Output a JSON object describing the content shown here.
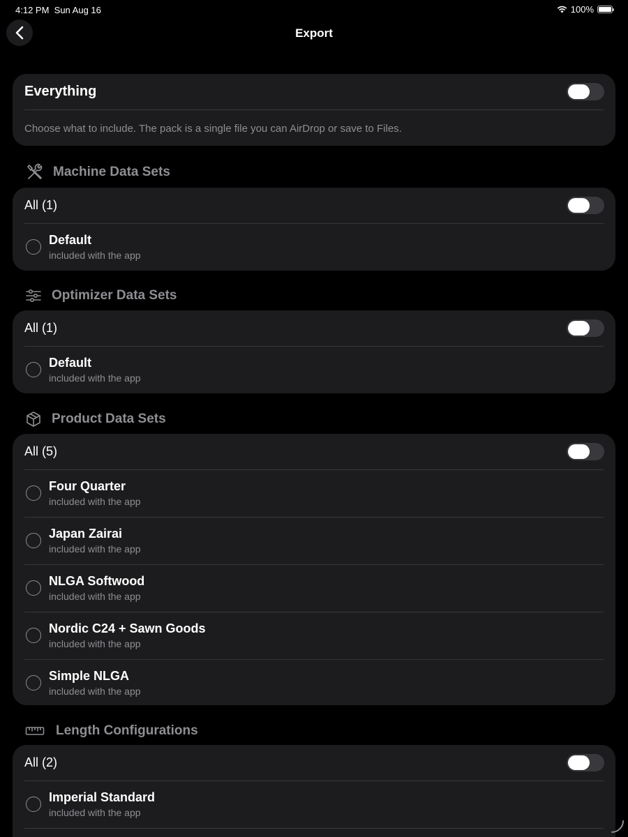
{
  "status": {
    "time": "4:12 PM",
    "date": "Sun Aug 16",
    "battery": "100%"
  },
  "nav": {
    "title": "Export"
  },
  "everything": {
    "label": "Everything",
    "description": "Choose what to include. The pack is a single file you can AirDrop or save to Files.",
    "toggle_on": false
  },
  "sections": [
    {
      "title": "Machine Data Sets",
      "icon": "tools-icon",
      "all_label": "All (1)",
      "toggle_on": false,
      "items": [
        {
          "title": "Default",
          "subtitle": "included with the app"
        }
      ]
    },
    {
      "title": "Optimizer Data Sets",
      "icon": "sliders-icon",
      "all_label": "All (1)",
      "toggle_on": false,
      "items": [
        {
          "title": "Default",
          "subtitle": "included with the app"
        }
      ]
    },
    {
      "title": "Product Data Sets",
      "icon": "box-icon",
      "all_label": "All (5)",
      "toggle_on": false,
      "items": [
        {
          "title": "Four Quarter",
          "subtitle": "included with the app"
        },
        {
          "title": "Japan Zairai",
          "subtitle": "included with the app"
        },
        {
          "title": "NLGA Softwood",
          "subtitle": "included with the app"
        },
        {
          "title": "Nordic C24 + Sawn Goods",
          "subtitle": "included with the app"
        },
        {
          "title": "Simple NLGA",
          "subtitle": "included with the app"
        }
      ]
    },
    {
      "title": "Length Configurations",
      "icon": "ruler-icon",
      "all_label": "All (2)",
      "toggle_on": false,
      "items": [
        {
          "title": "Imperial Standard",
          "subtitle": "included with the app"
        }
      ]
    }
  ]
}
